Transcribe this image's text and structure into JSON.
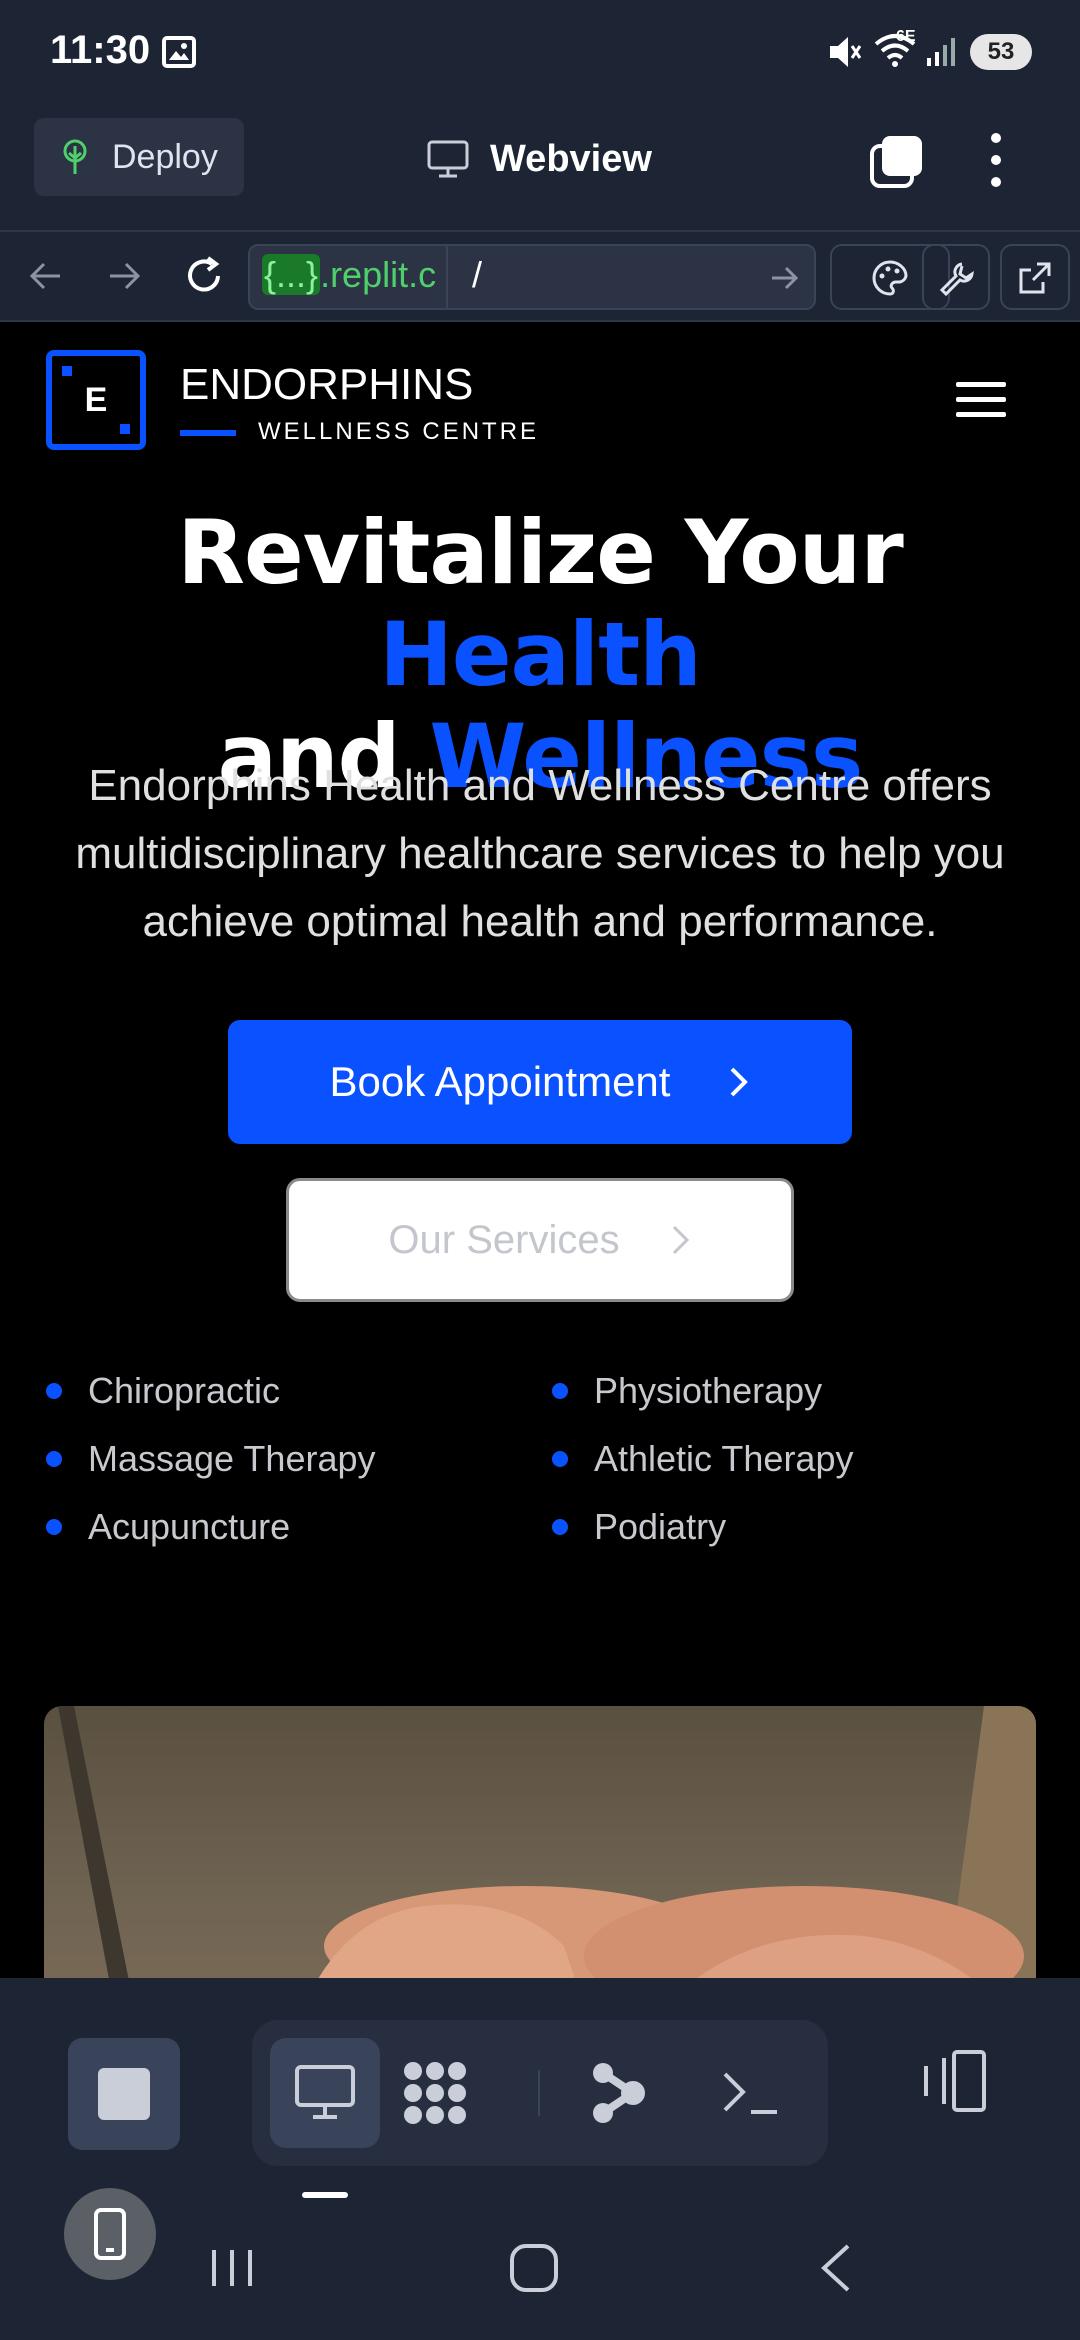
{
  "status_bar": {
    "time": "11:30",
    "network": "6E",
    "battery": "53"
  },
  "replit_header": {
    "deploy_label": "Deploy",
    "title": "Webview"
  },
  "url_bar": {
    "host_highlight": "{...}",
    "host_rest": ".replit.c",
    "path": "/"
  },
  "site": {
    "logo_letter": "E",
    "brand_name": "ENDORPHINS",
    "brand_sub": "WELLNESS CENTRE",
    "hero_line1_white": "Revitalize Your ",
    "hero_line1_blue": "Health",
    "hero_line2_white": "and ",
    "hero_line2_blue": "Wellness",
    "description": "Endorphins Health and Wellness Centre offers multidisciplinary healthcare services to help you achieve optimal health and performance.",
    "book_button": "Book Appointment",
    "services_button": "Our Services",
    "services": [
      "Chiropractic",
      "Physiotherapy",
      "Massage Therapy",
      "Athletic Therapy",
      "Acupuncture",
      "Podiatry"
    ]
  },
  "colors": {
    "accent": "#0a52ff",
    "chrome_bg": "#1d2433",
    "page_bg": "#000000",
    "url_green": "#4fd06a"
  },
  "icons": [
    "gallery-icon",
    "mute-icon",
    "wifi-icon",
    "signal-icon",
    "deploy-icon",
    "monitor-icon",
    "tabs-icon",
    "more-icon",
    "back-icon",
    "forward-icon",
    "reload-icon",
    "go-icon",
    "palette-icon",
    "wrench-icon",
    "external-link-icon",
    "menu-icon",
    "stop-icon",
    "webview-icon",
    "packages-icon",
    "git-icon",
    "shell-icon",
    "layout-icon",
    "phone-icon",
    "recents-icon",
    "home-icon",
    "back-nav-icon"
  ]
}
